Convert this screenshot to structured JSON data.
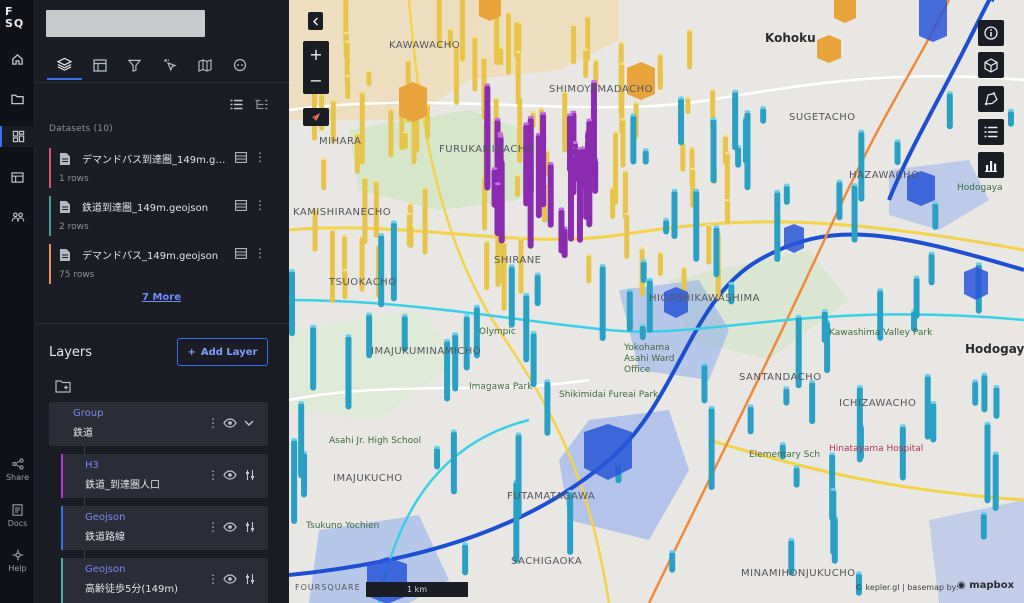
{
  "rail": {
    "logo_line1": "F",
    "logo_line2": "SQ",
    "share_label": "Share",
    "docs_label": "Docs",
    "help_label": "Help"
  },
  "panel": {
    "datasets_title": "Datasets (10)",
    "datasets": [
      {
        "name": "デマンドバス到達圏_149m.ge...",
        "rows": "1 rows",
        "color": "#e04f72"
      },
      {
        "name": "鉄道到達圏_149m.geojson",
        "rows": "2 rows",
        "color": "#4f9a9a"
      },
      {
        "name": "デマンドバス_149m.geojson",
        "rows": "75 rows",
        "color": "#e89060"
      }
    ],
    "more_link": "7 More",
    "layers_title": "Layers",
    "add_layer": "Add Layer",
    "layers": [
      {
        "type": "Group",
        "name": "鉄道",
        "color": "#2a2d36"
      },
      {
        "type": "H3",
        "name": "鉄道_到達圏人口",
        "color": "#b13cc8"
      },
      {
        "type": "Geojson",
        "name": "鉄道路線",
        "color": "#3b6df0"
      },
      {
        "type": "Geojson",
        "name": "高齢徒歩5分(149m)",
        "color": "#5aa7a7"
      }
    ]
  },
  "map": {
    "labels": [
      {
        "text": "Kohoku",
        "cls": "big"
      },
      {
        "text": "Hodogay",
        "cls": "big"
      },
      {
        "text": "KAWAWACHO",
        "cls": ""
      },
      {
        "text": "SHIMOYAMADACHO",
        "cls": ""
      },
      {
        "text": "MIHARA",
        "cls": ""
      },
      {
        "text": "FURUKAMIDACHO",
        "cls": ""
      },
      {
        "text": "KAMISHIRANECHO",
        "cls": ""
      },
      {
        "text": "IMAJUKUMINAMICHO",
        "cls": ""
      },
      {
        "text": "IMAJUKUCHO",
        "cls": ""
      },
      {
        "text": "FUTAMATAGAWA",
        "cls": ""
      },
      {
        "text": "SACHIGAOKA",
        "cls": ""
      },
      {
        "text": "MINAMIHONJUKUCHO",
        "cls": ""
      },
      {
        "text": "SANTANDACHO",
        "cls": ""
      },
      {
        "text": "ICHIZAWACHO",
        "cls": ""
      },
      {
        "text": "HAZAWACHO",
        "cls": ""
      },
      {
        "text": "SHIRANE",
        "cls": ""
      },
      {
        "text": "HIGASHIKAWASHIMA",
        "cls": ""
      },
      {
        "text": "TSUOKACHO",
        "cls": ""
      },
      {
        "text": "SUGETACHO",
        "cls": ""
      },
      {
        "text": "Olympic",
        "cls": "poi"
      },
      {
        "text": "Imagawa Park",
        "cls": "poi"
      },
      {
        "text": "Shikimidai Fureai Park",
        "cls": "poi"
      },
      {
        "text": "Yokohama Asahi Ward Office",
        "cls": "poi"
      },
      {
        "text": "Asahi Jr. High School",
        "cls": "poi"
      },
      {
        "text": "Hinatayama Hospital",
        "cls": "hosp"
      },
      {
        "text": "Elementary Sch",
        "cls": "poi"
      },
      {
        "text": "Tsukuno Yochien",
        "cls": "poi"
      },
      {
        "text": "Hodogaya",
        "cls": "poi"
      },
      {
        "text": "Kawashima Valley Park",
        "cls": "poi"
      }
    ],
    "zoom_in": "+",
    "zoom_out": "−",
    "scale_label": "1 km",
    "attribution": "© kepler.gl | basemap by:",
    "mapbox": "mapbox",
    "watermark": "FOURSQUARE"
  },
  "colors": {
    "accent": "#3b6df0",
    "panel_bg": "#1b1d24",
    "rail_bg": "#111217",
    "h3_purple": "#8a2bb0",
    "column_yellow": "#e6c54a",
    "column_teal": "#2aa1c4",
    "rail_blue": "#1f4fd1"
  },
  "icons": {
    "rail": [
      "home-icon",
      "folder-icon",
      "layers-icon",
      "table-icon",
      "people-icon",
      "share-icon",
      "docs-icon",
      "help-icon"
    ],
    "tabs": [
      "layers-tab-icon",
      "panels-tab-icon",
      "filter-tab-icon",
      "interactions-tab-icon",
      "basemap-tab-icon",
      "ai-tab-icon"
    ],
    "map_controls": [
      "info-icon",
      "cube-icon",
      "draw-icon",
      "legend-icon",
      "chart-icon"
    ]
  }
}
